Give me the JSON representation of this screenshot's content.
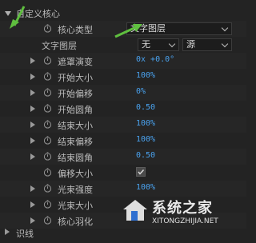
{
  "section": {
    "title": "自定义核心"
  },
  "core_type": {
    "label": "核心类型",
    "value": "文字图层"
  },
  "text_layer": {
    "label": "文字图层",
    "select1": "无",
    "select2": "源"
  },
  "properties": [
    {
      "label": "遮罩演变",
      "value": "0x +0.0°"
    },
    {
      "label": "开始大小",
      "value": "100%"
    },
    {
      "label": "开始偏移",
      "value": "0%"
    },
    {
      "label": "开始圆角",
      "value": "0.50"
    },
    {
      "label": "结束大小",
      "value": "100%"
    },
    {
      "label": "结束偏移",
      "value": "100%"
    },
    {
      "label": "结束圆角",
      "value": "0.50"
    },
    {
      "label": "偏移大小",
      "value": ""
    },
    {
      "label": "光束强度",
      "value": "100%"
    },
    {
      "label": "光束大小",
      "value": ""
    },
    {
      "label": "核心羽化",
      "value": ""
    }
  ],
  "footer": {
    "partial_label": "识线"
  },
  "watermark": {
    "brand": "系统之家",
    "url": "XITONGZHIJIA.NET"
  },
  "colors": {
    "accent_value": "#4aa3f0",
    "annotation_arrow": "#5fbf3f"
  }
}
